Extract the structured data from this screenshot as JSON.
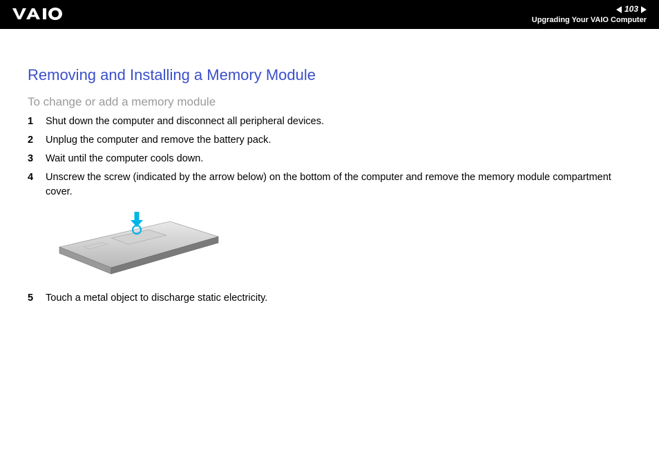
{
  "header": {
    "page_number": "103",
    "section": "Upgrading Your VAIO Computer"
  },
  "content": {
    "title": "Removing and Installing a Memory Module",
    "subtitle": "To change or add a memory module",
    "steps": [
      {
        "num": "1",
        "text": "Shut down the computer and disconnect all peripheral devices."
      },
      {
        "num": "2",
        "text": "Unplug the computer and remove the battery pack."
      },
      {
        "num": "3",
        "text": "Wait until the computer cools down."
      },
      {
        "num": "4",
        "text": "Unscrew the screw (indicated by the arrow below) on the bottom of the computer and remove the memory module compartment cover."
      },
      {
        "num": "5",
        "text": "Touch a metal object to discharge static electricity."
      }
    ]
  }
}
